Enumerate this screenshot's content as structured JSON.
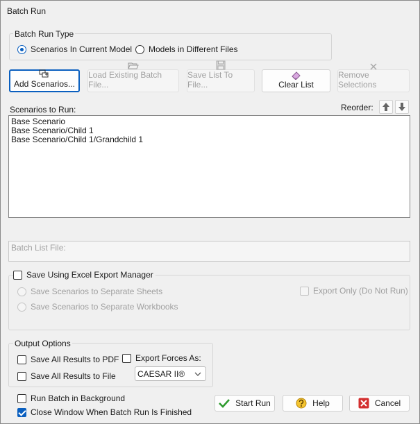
{
  "window": {
    "title": "Batch Run"
  },
  "batch_run_type": {
    "label": "Batch Run Type",
    "options": [
      {
        "label": "Scenarios In Current Model",
        "checked": true
      },
      {
        "label": "Models in Different Files",
        "checked": false
      }
    ]
  },
  "toolbar": {
    "add_scenarios": "Add Scenarios...",
    "load_batch_file": "Load Existing Batch File...",
    "save_list": "Save List To File...",
    "clear_list": "Clear List",
    "remove_selections": "Remove Selections"
  },
  "scenarios": {
    "label": "Scenarios to Run:",
    "reorder_label": "Reorder:",
    "items": [
      "Base Scenario",
      "Base Scenario/Child 1",
      "Base Scenario/Child 1/Grandchild 1"
    ]
  },
  "batch_list_file": {
    "label": "Batch List File:",
    "value": ""
  },
  "excel": {
    "label": "Save Using Excel Export Manager",
    "checked": false,
    "options": [
      "Save Scenarios to Separate Sheets",
      "Save Scenarios to Separate Workbooks"
    ],
    "export_only": "Export Only (Do Not Run)"
  },
  "output_options": {
    "label": "Output Options",
    "save_pdf": "Save All Results to PDF",
    "save_file": "Save All Results to File",
    "export_forces": "Export Forces As:",
    "export_format": "CAESAR II®"
  },
  "footer": {
    "run_background": "Run Batch in Background",
    "run_background_checked": false,
    "close_window": "Close Window When Batch Run Is Finished",
    "close_window_checked": true,
    "start_run": "Start Run",
    "help": "Help",
    "cancel": "Cancel"
  },
  "colors": {
    "accent": "#0a5fbf",
    "start_green": "#2e9b2e",
    "cancel_red": "#d32f2f"
  }
}
